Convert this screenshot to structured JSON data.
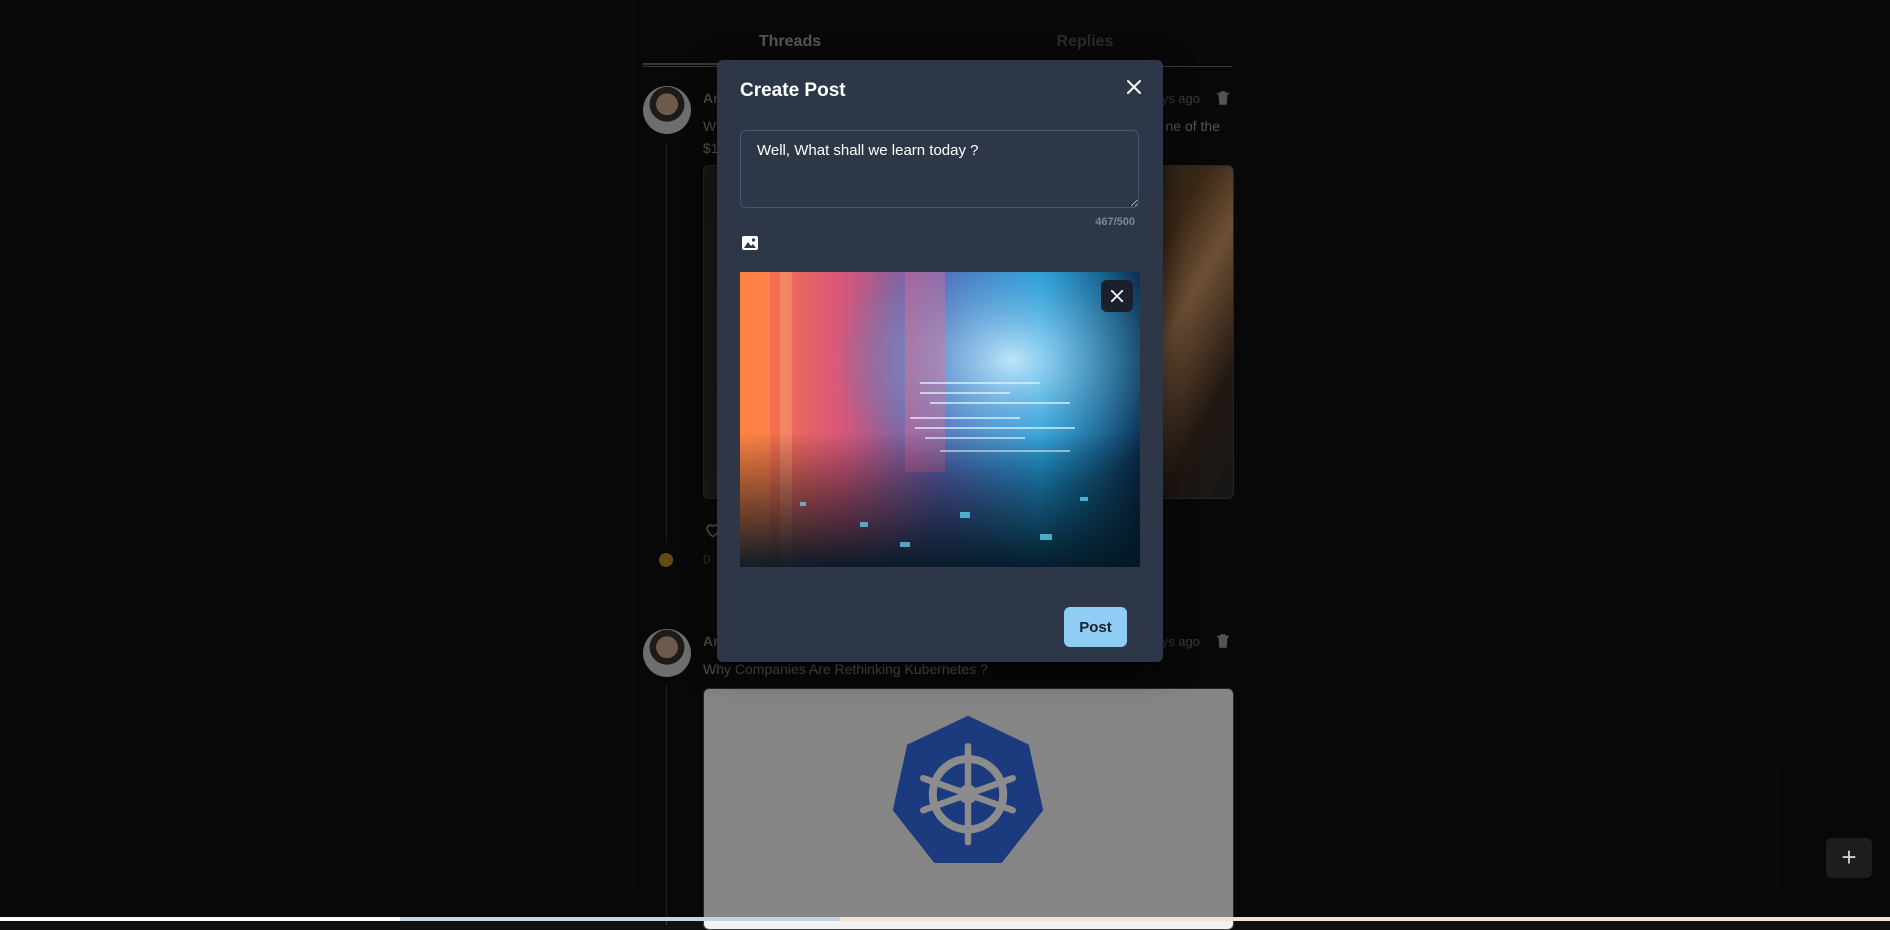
{
  "feed": {
    "tabs": [
      {
        "label": "Threads"
      },
      {
        "label": "Replies"
      }
    ],
    "posts": [
      {
        "user_partial": "An",
        "time_partial": "ys ago",
        "text_partial_start": "W",
        "text_partial_end": "ne of the",
        "second_line_partial": "$1",
        "reactions_partial": "0 "
      },
      {
        "user_partial": "An",
        "time_partial": "ys ago",
        "text": "Why Companies Are Rethinking Kubernetes ?"
      }
    ]
  },
  "modal": {
    "title": "Create Post",
    "textarea_value": "Well, What shall we learn today ?",
    "char_count": "467/500",
    "post_label": "Post"
  },
  "fab": {
    "label": "+"
  },
  "icons": [
    "close-icon",
    "image-icon",
    "trash-icon",
    "heart-icon",
    "plus-icon"
  ],
  "colors": {
    "modal_bg": "#2d3748",
    "post_button": "#90cdf4",
    "page_bg": "#101010"
  }
}
